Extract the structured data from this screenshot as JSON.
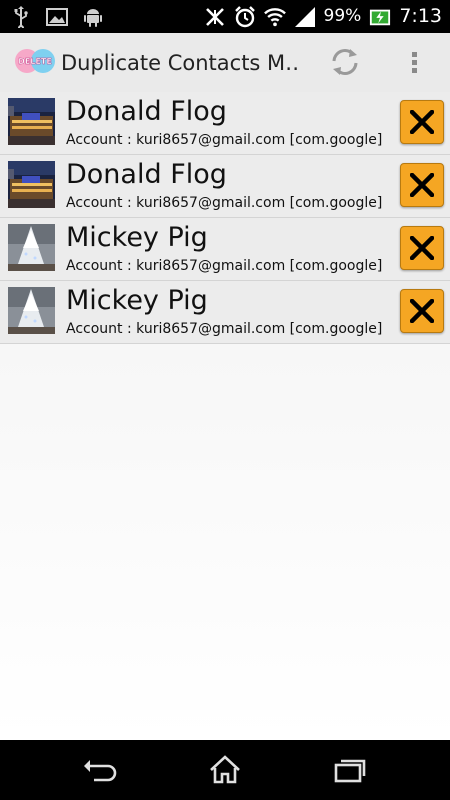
{
  "status_bar": {
    "battery_percent": "99%",
    "time": "7:13",
    "icons": [
      "usb-icon",
      "image-icon",
      "android-icon",
      "mute-icon",
      "alarm-icon",
      "wifi-icon",
      "signal-icon",
      "battery-charging-icon"
    ]
  },
  "action_bar": {
    "logo_text": "DELETE",
    "title": "Duplicate Contacts M…",
    "refresh_icon": "refresh-icon",
    "overflow_icon": "overflow-menu-icon"
  },
  "contacts": [
    {
      "name": "Donald Flog",
      "account": "Account : kuri8657@gmail.com [com.google]",
      "photo": "night-building"
    },
    {
      "name": "Donald Flog",
      "account": "Account : kuri8657@gmail.com [com.google]",
      "photo": "night-building"
    },
    {
      "name": "Mickey Pig",
      "account": "Account : kuri8657@gmail.com [com.google]",
      "photo": "christmas-tree"
    },
    {
      "name": "Mickey Pig",
      "account": "Account : kuri8657@gmail.com [com.google]",
      "photo": "christmas-tree"
    }
  ],
  "nav_bar": {
    "icons": [
      "back-icon",
      "home-icon",
      "recent-apps-icon"
    ]
  },
  "colors": {
    "delete_button": "#f5a623",
    "action_bar": "#eaeaea",
    "list_item": "#ececec"
  }
}
